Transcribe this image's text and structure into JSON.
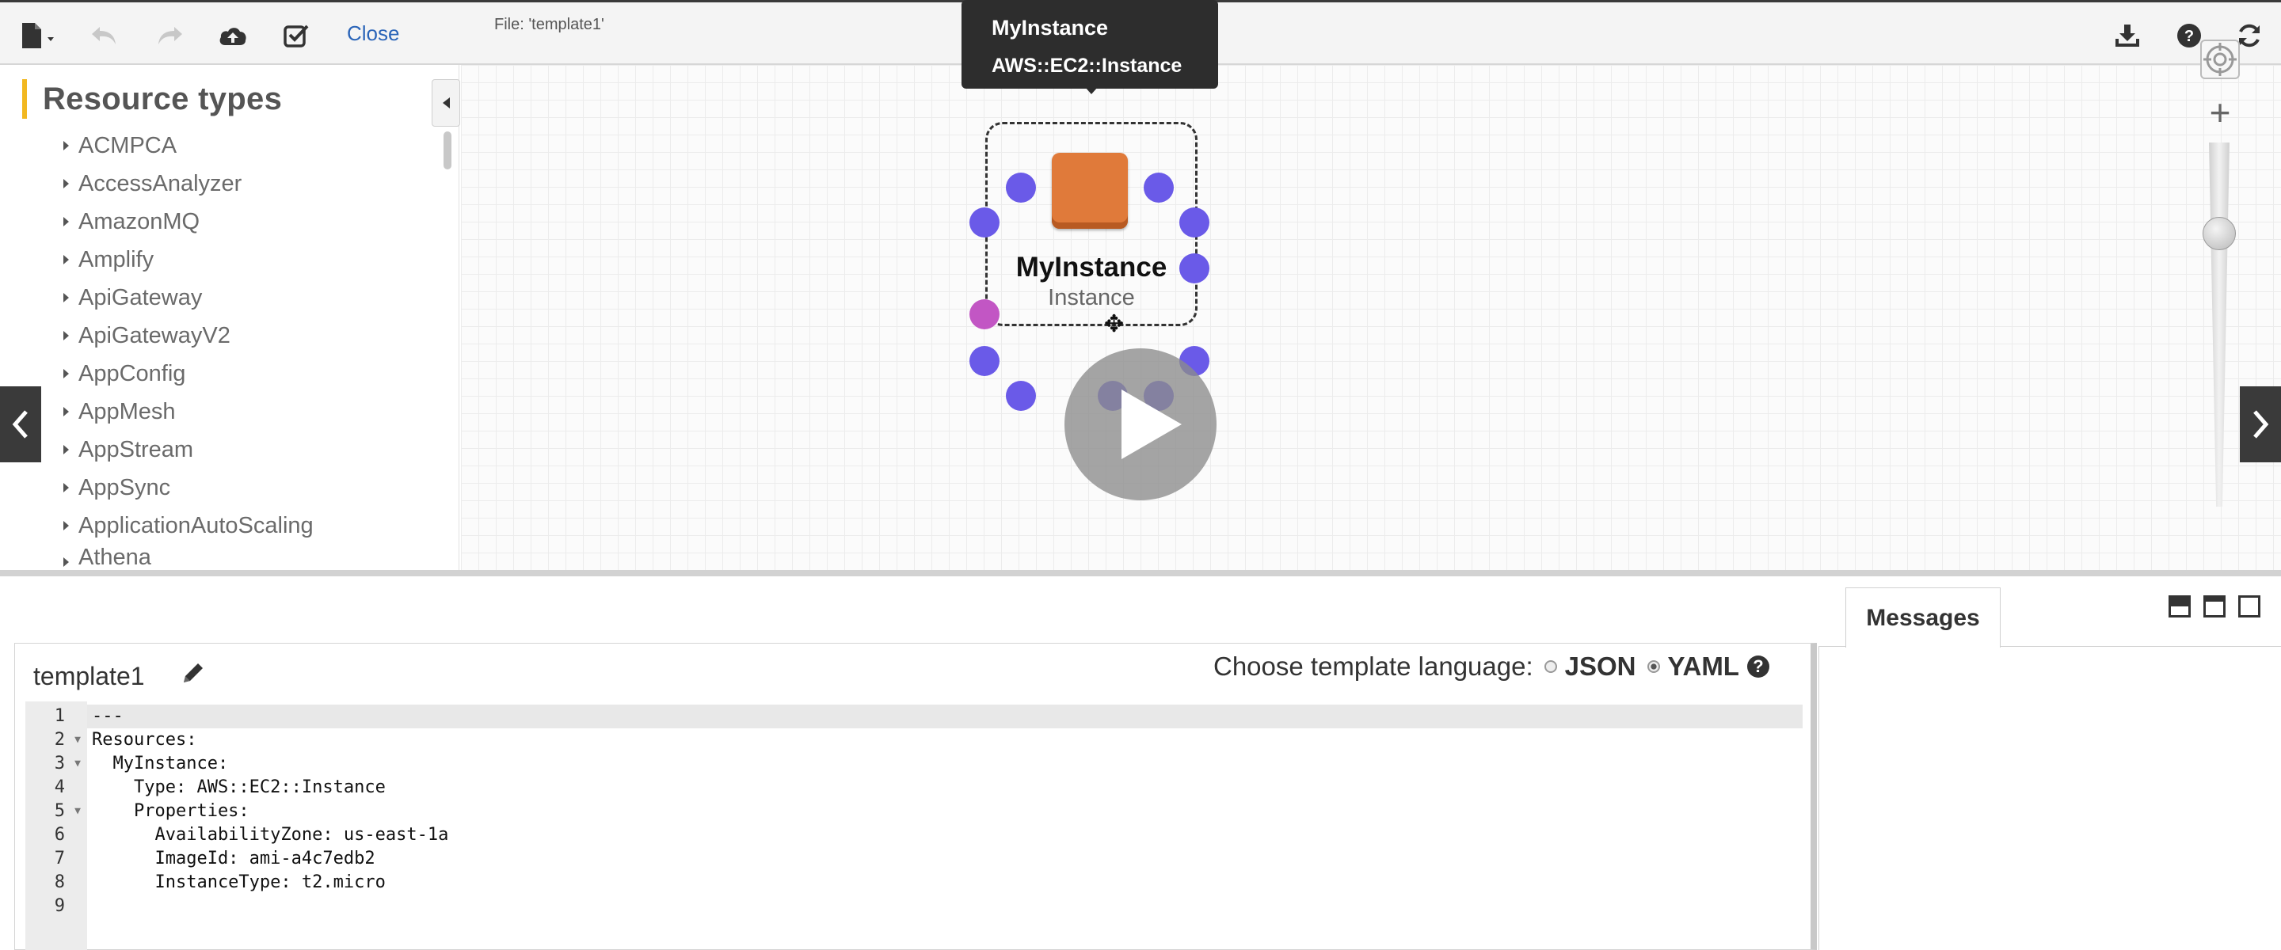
{
  "toolbar": {
    "close_label": "Close",
    "icons": [
      "file-icon",
      "undo-icon",
      "redo-icon",
      "cloud-upload-icon",
      "validate-icon",
      "download-icon",
      "help-icon",
      "refresh-icon"
    ]
  },
  "sidebar": {
    "title": "Resource types",
    "items": [
      "ACMPCA",
      "AccessAnalyzer",
      "AmazonMQ",
      "Amplify",
      "ApiGateway",
      "ApiGatewayV2",
      "AppConfig",
      "AppMesh",
      "AppStream",
      "AppSync",
      "ApplicationAutoScaling",
      "Athena"
    ]
  },
  "canvas": {
    "file_label": "File: 'template1'",
    "tooltip": {
      "name": "MyInstance",
      "type": "AWS::EC2::Instance"
    },
    "node": {
      "name": "MyInstance",
      "type": "Instance",
      "icon": "ec2-instance-icon",
      "icon_color": "#e07a3a",
      "port_color": "#6a5ae8",
      "active_port_color": "#c256c4"
    }
  },
  "editor": {
    "template_name": "template1",
    "language_label": "Choose template language:",
    "languages": [
      "JSON",
      "YAML"
    ],
    "selected_language": "YAML",
    "lines": [
      {
        "num": "1",
        "text": "---"
      },
      {
        "num": "2",
        "text": "Resources:"
      },
      {
        "num": "3",
        "text": "  MyInstance:"
      },
      {
        "num": "4",
        "text": "    Type: AWS::EC2::Instance"
      },
      {
        "num": "5",
        "text": "    Properties:"
      },
      {
        "num": "6",
        "text": "      AvailabilityZone: us-east-1a"
      },
      {
        "num": "7",
        "text": "      ImageId: ami-a4c7edb2"
      },
      {
        "num": "8",
        "text": "      InstanceType: t2.micro"
      },
      {
        "num": "9",
        "text": ""
      }
    ]
  },
  "messages": {
    "tab_label": "Messages"
  }
}
